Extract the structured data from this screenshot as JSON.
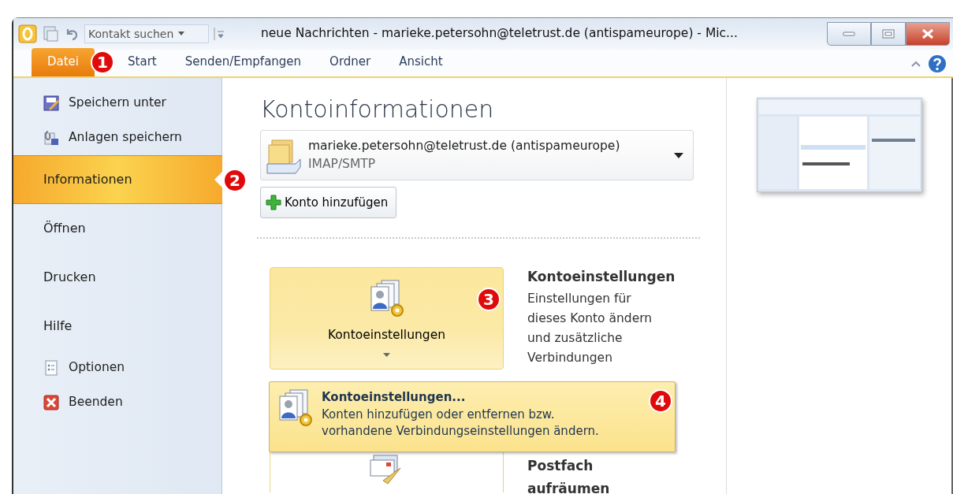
{
  "window": {
    "title": "neue Nachrichten - marieke.petersohn@teletrust.de (antispameurope) - Mic..."
  },
  "quick_access": {
    "search": {
      "value": "Kontakt suchen"
    }
  },
  "ribbon_tabs": [
    {
      "label": "Datei",
      "selected": true
    },
    {
      "label": "Start",
      "selected": false
    },
    {
      "label": "Senden/Empfangen",
      "selected": false
    },
    {
      "label": "Ordner",
      "selected": false
    },
    {
      "label": "Ansicht",
      "selected": false
    }
  ],
  "sidebar": {
    "items": [
      {
        "label": "Speichern unter",
        "kind": "command",
        "selected": false
      },
      {
        "label": "Anlagen speichern",
        "kind": "command",
        "selected": false
      },
      {
        "label": "Informationen",
        "kind": "section",
        "selected": true
      },
      {
        "label": "Öffnen",
        "kind": "section",
        "selected": false
      },
      {
        "label": "Drucken",
        "kind": "section",
        "selected": false
      },
      {
        "label": "Hilfe",
        "kind": "section",
        "selected": false
      },
      {
        "label": "Optionen",
        "kind": "command",
        "selected": false
      },
      {
        "label": "Beenden",
        "kind": "command",
        "selected": false
      }
    ]
  },
  "account_info": {
    "heading": "Kontoinformationen",
    "account": {
      "email": "marieke.petersohn@teletrust.de (antispameurope)",
      "type": "IMAP/SMTP"
    },
    "add_button": "Konto hinzufügen"
  },
  "actions": [
    {
      "button": "Kontoeinstellungen",
      "title": "Kontoeinstellungen",
      "description": [
        "Einstellungen für",
        "dieses Konto ändern",
        "und zusätzliche",
        "Verbindungen"
      ],
      "highlighted": true
    },
    {
      "title": "Postfach",
      "title_2": "aufräumen",
      "highlighted": false
    }
  ],
  "dropdown_menu": {
    "items": [
      {
        "title": "Kontoeinstellungen...",
        "description": [
          "Konten hinzufügen oder entfernen bzw.",
          "vorhandene Verbindungseinstellungen ändern."
        ],
        "selected": true
      }
    ]
  },
  "callouts": [
    "1",
    "2",
    "3",
    "4"
  ]
}
